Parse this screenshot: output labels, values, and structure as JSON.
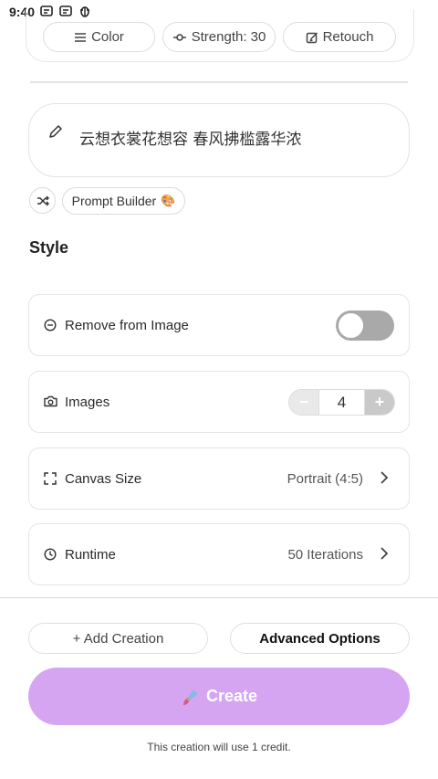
{
  "status": {
    "time": "9:40",
    "icons": [
      "app-notification-icon",
      "app-notification-icon",
      "bug-icon"
    ]
  },
  "chips": {
    "color": "Color",
    "strength": "Strength: 30",
    "retouch": "Retouch"
  },
  "prompt": {
    "text": "云想衣裳花想容 春风拂槛露华浓"
  },
  "prompt_builder": {
    "label": "Prompt Builder",
    "emoji": "🎨"
  },
  "style": {
    "title": "Style",
    "remove_from_image": {
      "label": "Remove from Image",
      "enabled": false
    },
    "images": {
      "label": "Images",
      "value": "4"
    },
    "canvas_size": {
      "label": "Canvas Size",
      "value": "Portrait (4:5)"
    },
    "runtime": {
      "label": "Runtime",
      "value": "50 Iterations"
    }
  },
  "actions": {
    "add_creation": "+ Add Creation",
    "advanced_options": "Advanced Options",
    "create": "Create",
    "credit_note": "This creation will use 1 credit."
  },
  "colors": {
    "create_button": "#d6a5f2",
    "toggle_off": "#a9a9a9"
  }
}
